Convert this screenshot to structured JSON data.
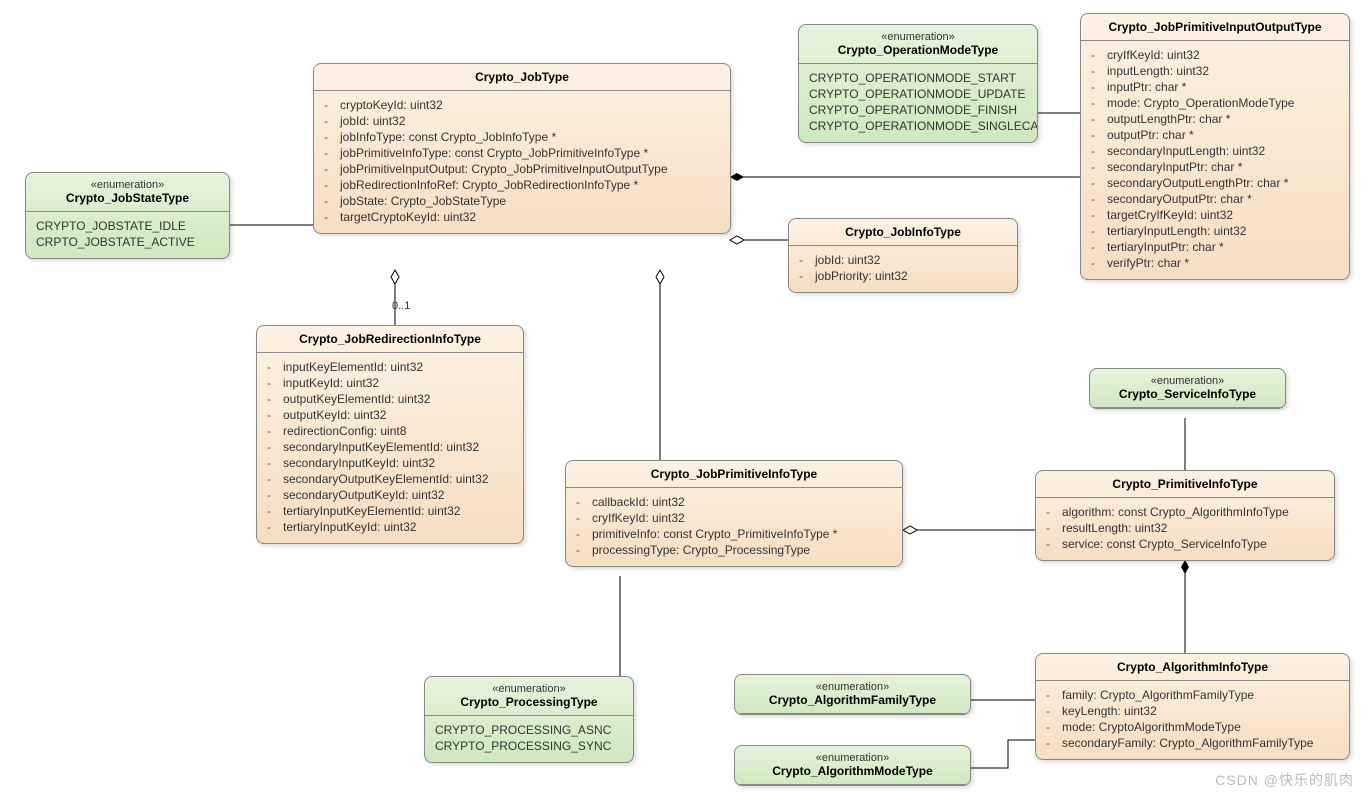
{
  "stereo_enum": "«enumeration»",
  "watermark": "CSDN @快乐的肌肉",
  "mult_0_1": "0..1",
  "jobStateType": {
    "name": "Crypto_JobStateType",
    "items": [
      "CRYPTO_JOBSTATE_IDLE",
      "CRPTO_JOBSTATE_ACTIVE"
    ]
  },
  "jobType": {
    "name": "Crypto_JobType",
    "attrs": [
      "cryptoKeyId: uint32",
      "jobId: uint32",
      "jobInfoType: const Crypto_JobInfoType *",
      "jobPrimitiveInfoType: const Crypto_JobPrimitiveInfoType *",
      "jobPrimitiveInputOutput: Crypto_JobPrimitiveInputOutputType",
      "jobRedirectionInfoRef: Crypto_JobRedirectionInfoType *",
      "jobState: Crypto_JobStateType",
      "targetCryptoKeyId: uint32"
    ]
  },
  "operationModeType": {
    "name": "Crypto_OperationModeType",
    "items": [
      "CRYPTO_OPERATIONMODE_START",
      "CRYPTO_OPERATIONMODE_UPDATE",
      "CRYPTO_OPERATIONMODE_FINISH",
      "CRYPTO_OPERATIONMODE_SINGLECALL"
    ]
  },
  "jobPrimitiveIOType": {
    "name": "Crypto_JobPrimitiveInputOutputType",
    "attrs": [
      "cryIfKeyId: uint32",
      "inputLength: uint32",
      "inputPtr: char *",
      "mode: Crypto_OperationModeType",
      "outputLengthPtr: char *",
      "outputPtr: char *",
      "secondaryInputLength: uint32",
      "secondaryInputPtr: char *",
      "secondaryOutputLengthPtr: char *",
      "secondaryOutputPtr: char *",
      "targetCryIfKeyId: uint32",
      "tertiaryInputLength: uint32",
      "tertiaryInputPtr: char *",
      "verifyPtr: char *"
    ]
  },
  "jobInfoType": {
    "name": "Crypto_JobInfoType",
    "attrs": [
      "jobId: uint32",
      "jobPriority: uint32"
    ]
  },
  "jobRedirectionInfoType": {
    "name": "Crypto_JobRedirectionInfoType",
    "attrs": [
      "inputKeyElementId: uint32",
      "inputKeyId: uint32",
      "outputKeyElementId: uint32",
      "outputKeyId: uint32",
      "redirectionConfig: uint8",
      "secondaryInputKeyElementId: uint32",
      "secondaryInputKeyId: uint32",
      "secondaryOutputKeyElementId: uint32",
      "secondaryOutputKeyId: uint32",
      "tertiaryInputKeyElementId: uint32",
      "tertiaryInputKeyId: uint32"
    ]
  },
  "jobPrimitiveInfoType": {
    "name": "Crypto_JobPrimitiveInfoType",
    "attrs": [
      "callbackId: uint32",
      "cryIfKeyId: uint32",
      "primitiveInfo: const Crypto_PrimitiveInfoType *",
      "processingType: Crypto_ProcessingType"
    ]
  },
  "processingType": {
    "name": "Crypto_ProcessingType",
    "items": [
      "CRYPTO_PROCESSING_ASNC",
      "CRYPTO_PROCESSING_SYNC"
    ]
  },
  "serviceInfoType": {
    "name": "Crypto_ServiceInfoType"
  },
  "primitiveInfoType": {
    "name": "Crypto_PrimitiveInfoType",
    "attrs": [
      "algorithm: const Crypto_AlgorithmInfoType",
      "resultLength: uint32",
      "service: const Crypto_ServiceInfoType"
    ]
  },
  "algorithmInfoType": {
    "name": "Crypto_AlgorithmInfoType",
    "attrs": [
      "family: Crypto_AlgorithmFamilyType",
      "keyLength: uint32",
      "mode: CryptoAlgorithmModeType",
      "secondaryFamily: Crypto_AlgorithmFamilyType"
    ]
  },
  "algorithmFamilyType": {
    "name": "Crypto_AlgorithmFamilyType"
  },
  "algorithmModeType": {
    "name": "Crypto_AlgorithmModeType"
  }
}
